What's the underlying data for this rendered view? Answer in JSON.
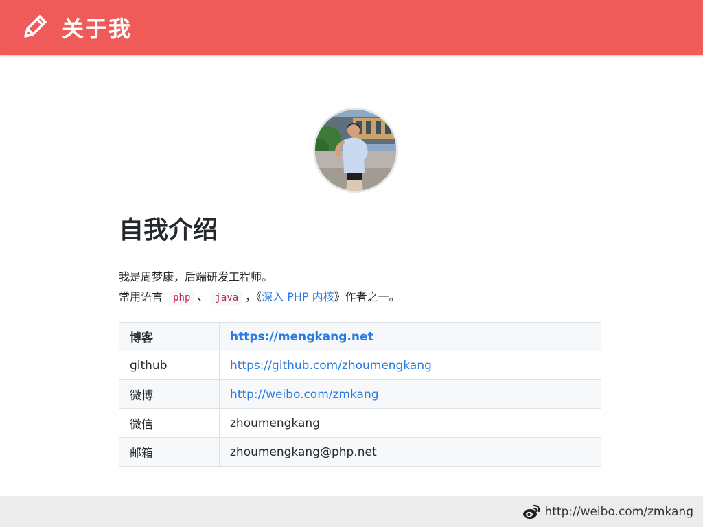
{
  "header": {
    "title": "关于我"
  },
  "avatar": {
    "alt": "周梦康"
  },
  "intro": {
    "heading": "自我介绍",
    "line1": "我是周梦康，后端研发工程师。",
    "line2_prefix": "常用语言",
    "code1": "php",
    "sep1": "、",
    "code2": "java",
    "sep2": "，《",
    "book_link": "深入 PHP 内核",
    "line2_suffix": "》作者之一。"
  },
  "table": {
    "rows": [
      {
        "key": "博客",
        "value": "https://mengkang.net",
        "is_link": true,
        "bold": true
      },
      {
        "key": "github",
        "value": "https://github.com/zhoumengkang",
        "is_link": true,
        "bold": false
      },
      {
        "key": "微博",
        "value": "http://weibo.com/zmkang",
        "is_link": true,
        "bold": false
      },
      {
        "key": "微信",
        "value": "zhoumengkang",
        "is_link": false,
        "bold": false
      },
      {
        "key": "邮箱",
        "value": "zhoumengkang@php.net",
        "is_link": false,
        "bold": false
      }
    ]
  },
  "footer": {
    "url": "http://weibo.com/zmkang"
  },
  "colors": {
    "header_bg": "#ef5b58",
    "link": "#2a7ae2",
    "code_text": "#c7254e",
    "footer_bg": "#ececec"
  }
}
